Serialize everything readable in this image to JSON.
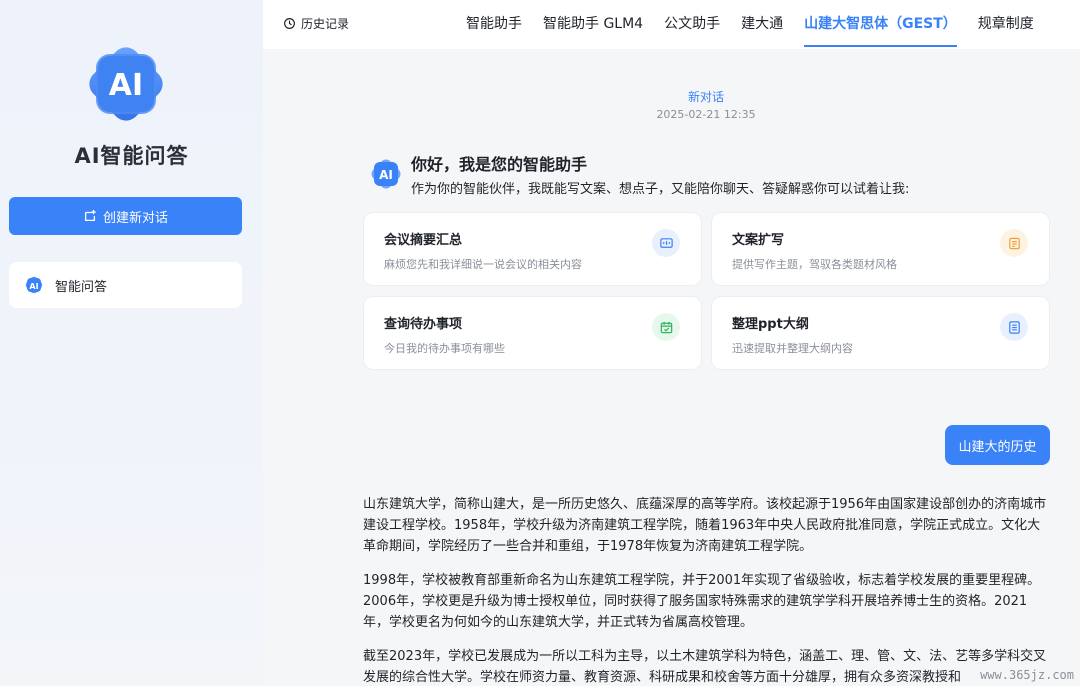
{
  "app": {
    "title": "AI智能问答",
    "logo_text": "AI",
    "accent_color": "#3a82f7"
  },
  "sidebar": {
    "new_chat_label": "创建新对话",
    "items": [
      {
        "label": "智能问答",
        "icon": "ai-logo-icon"
      }
    ]
  },
  "topbar": {
    "history_label": "历史记录",
    "tabs": [
      {
        "label": "智能助手"
      },
      {
        "label": "智能助手 GLM4"
      },
      {
        "label": "公文助手"
      },
      {
        "label": "建大通"
      },
      {
        "label": "山建大智思体（GEST）",
        "active": true
      },
      {
        "label": "规章制度"
      }
    ]
  },
  "conversation": {
    "title": "新对话",
    "timestamp": "2025-02-21 12:35"
  },
  "greeting": {
    "title": "你好，我是您的智能助手",
    "subtitle": "作为你的智能伙伴，我既能写文案、想点子，又能陪你聊天、答疑解惑你可以试着让我:"
  },
  "cards": [
    {
      "title": "会议摘要汇总",
      "desc": "麻烦您先和我详细说一说会议的相关内容",
      "icon": "meeting-icon",
      "color": "#e8f0fd"
    },
    {
      "title": "文案扩写",
      "desc": "提供写作主题，驾驭各类题材风格",
      "icon": "document-icon",
      "color": "#fdf3e3"
    },
    {
      "title": "查询待办事项",
      "desc": "今日我的待办事项有哪些",
      "icon": "calendar-check-icon",
      "color": "#e6f7ec"
    },
    {
      "title": "整理ppt大纲",
      "desc": "迅速提取并整理大纲内容",
      "icon": "outline-icon",
      "color": "#e8f0fd"
    }
  ],
  "messages": {
    "user": "山建大的历史",
    "answer": [
      "山东建筑大学，简称山建大，是一所历史悠久、底蕴深厚的高等学府。该校起源于1956年由国家建设部创办的济南城市建设工程学校。1958年，学校升级为济南建筑工程学院，随着1963年中央人民政府批准同意，学院正式成立。文化大革命期间，学院经历了一些合并和重组，于1978年恢复为济南建筑工程学院。",
      "1998年，学校被教育部重新命名为山东建筑工程学院，并于2001年实现了省级验收，标志着学校发展的重要里程碑。2006年，学校更是升级为博士授权单位，同时获得了服务国家特殊需求的建筑学学科开展培养博士生的资格。2021年，学校更名为何如今的山东建筑大学，并正式转为省属高校管理。",
      "截至2023年，学校已发展成为一所以工科为主导，以土木建筑学科为特色，涵盖工、理、管、文、法、艺等多学科交叉发展的综合性大学。学校在师资力量、教育资源、科研成果和校舍等方面十分雄厚，拥有众多资深教授和"
    ]
  },
  "watermark": "www.365jz.com"
}
